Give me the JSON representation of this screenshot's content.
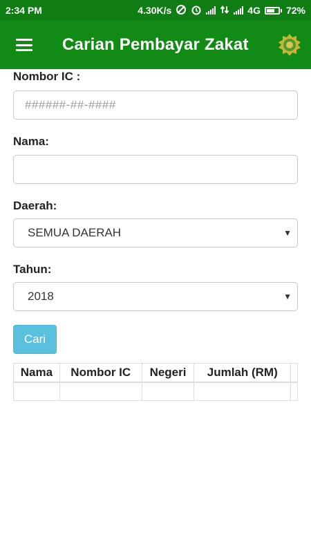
{
  "status_bar": {
    "time": "2:34 PM",
    "speed": "4.30K/s",
    "network": "4G",
    "battery": "72%",
    "battery_level": 0.72
  },
  "app_bar": {
    "title": "Carian Pembayar Zakat"
  },
  "form": {
    "ic_label": "Nombor IC :",
    "ic_placeholder": "######-##-####",
    "ic_value": "",
    "name_label": "Nama:",
    "name_value": "",
    "district_label": "Daerah:",
    "district_selected": "SEMUA DAERAH",
    "year_label": "Tahun:",
    "year_selected": "2018",
    "search_button": "Cari"
  },
  "table": {
    "columns": [
      "Nama",
      "Nombor IC",
      "Negeri",
      "Jumlah (RM)"
    ],
    "rows": []
  },
  "colors": {
    "status_bar": "#0f7d13",
    "app_bar": "#128a16",
    "button": "#5bc0de"
  }
}
